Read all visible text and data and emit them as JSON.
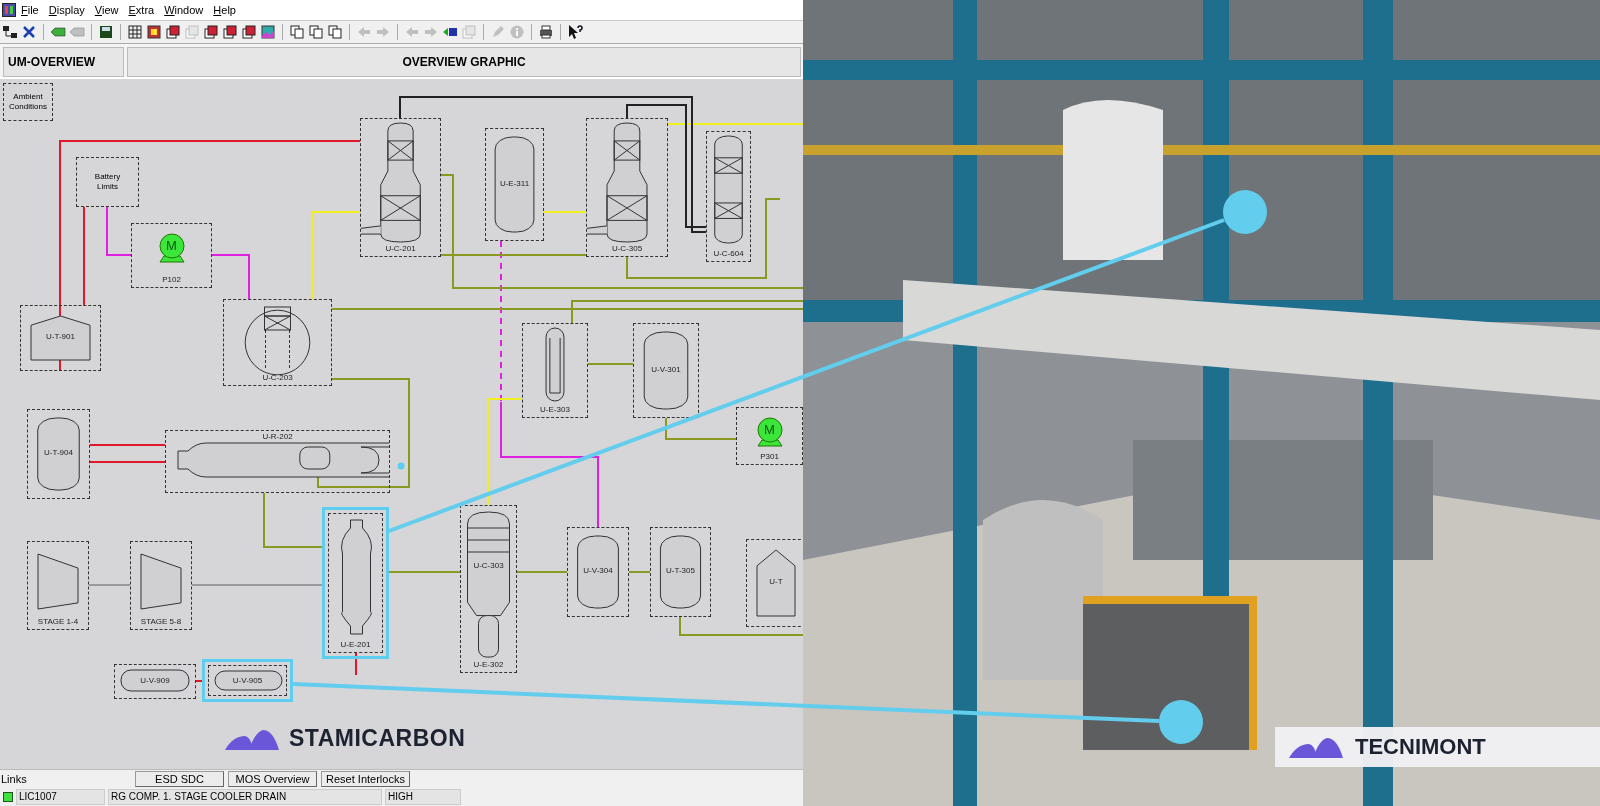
{
  "menu": [
    {
      "label": "File"
    },
    {
      "label": "Display"
    },
    {
      "label": "View"
    },
    {
      "label": "Extra"
    },
    {
      "label": "Window"
    },
    {
      "label": "Help"
    }
  ],
  "toolbar": [
    {
      "disabled": false
    },
    {
      "disabled": false
    },
    {
      "disabled": false
    },
    {
      "disabled": true
    },
    {
      "disabled": false
    },
    {
      "disabled": false
    },
    {
      "disabled": false
    },
    {
      "disabled": false
    },
    {
      "disabled": true
    },
    {
      "disabled": false
    },
    {
      "disabled": false
    },
    {
      "disabled": false
    },
    {
      "disabled": false
    },
    {
      "disabled": false
    },
    {
      "disabled": false
    },
    {
      "disabled": false
    },
    {
      "disabled": true
    },
    {
      "disabled": true
    },
    {
      "disabled": true
    },
    {
      "disabled": true
    },
    {
      "disabled": false
    },
    {
      "disabled": true
    },
    {
      "disabled": true
    },
    {
      "disabled": true
    },
    {
      "disabled": false
    },
    {
      "disabled": false
    }
  ],
  "header": {
    "tab": "UM-OVERVIEW",
    "title": "OVERVIEW GRAPHIC"
  },
  "equipment": [
    {
      "kind": "note",
      "labels": [
        "Ambient Conditions"
      ],
      "highlighted": false
    },
    {
      "kind": "note",
      "labels": [
        "Battery Limits"
      ],
      "highlighted": false
    },
    {
      "kind": "column",
      "labels": [
        "U-C-201"
      ],
      "highlighted": false
    },
    {
      "kind": "vessel",
      "labels": [
        "U-E-311"
      ],
      "highlighted": false
    },
    {
      "kind": "column",
      "labels": [
        "U-C-305"
      ],
      "highlighted": false
    },
    {
      "kind": "tray_column",
      "labels": [
        "U-C-604"
      ],
      "highlighted": false
    },
    {
      "kind": "pump",
      "symbol": "M",
      "labels": [
        "P102"
      ],
      "running": true,
      "highlighted": false
    },
    {
      "kind": "tank",
      "labels": [
        "U-T-901"
      ],
      "highlighted": false
    },
    {
      "kind": "scrubber",
      "labels": [
        "U-C-203"
      ],
      "highlighted": false
    },
    {
      "kind": "tube_vessel",
      "labels": [
        "U-E-303"
      ],
      "highlighted": false
    },
    {
      "kind": "vessel",
      "labels": [
        "U-V-301"
      ],
      "highlighted": false
    },
    {
      "kind": "vessel",
      "labels": [
        "U-T-904"
      ],
      "highlighted": false
    },
    {
      "kind": "reactor",
      "labels": [
        "U-R-202"
      ],
      "highlighted": false
    },
    {
      "kind": "pump",
      "symbol": "M",
      "labels": [
        "P301"
      ],
      "running": true,
      "highlighted": false
    },
    {
      "kind": "compressor",
      "labels": [
        "STAGE 1-4"
      ],
      "highlighted": false
    },
    {
      "kind": "compressor",
      "labels": [
        "STAGE 5-8"
      ],
      "highlighted": false
    },
    {
      "kind": "exchanger",
      "labels": [
        "U-E-201"
      ],
      "highlighted": true
    },
    {
      "kind": "tower",
      "labels": [
        "U-C-303",
        "U-E-302"
      ],
      "highlighted": false
    },
    {
      "kind": "vessel",
      "labels": [
        "U-V-304"
      ],
      "highlighted": false
    },
    {
      "kind": "vessel",
      "labels": [
        "U-T-305"
      ],
      "highlighted": false
    },
    {
      "kind": "tank",
      "labels": [
        "U-T"
      ],
      "highlighted": false
    },
    {
      "kind": "drum",
      "labels": [
        "U-V-909"
      ],
      "highlighted": false
    },
    {
      "kind": "drum",
      "labels": [
        "U-V-905"
      ],
      "highlighted": true
    }
  ],
  "brand_left": "STAMICARBON",
  "links": {
    "label": "Links",
    "buttons": [
      "ESD SDC",
      "MOS Overview",
      "Reset Interlocks"
    ]
  },
  "alarm": {
    "tag": "LIC1007",
    "description": "RG COMP. 1. STAGE COOLER DRAIN",
    "priority": "HIGH"
  },
  "video": {
    "kind": "picture",
    "brand": "TECNIMONT"
  }
}
